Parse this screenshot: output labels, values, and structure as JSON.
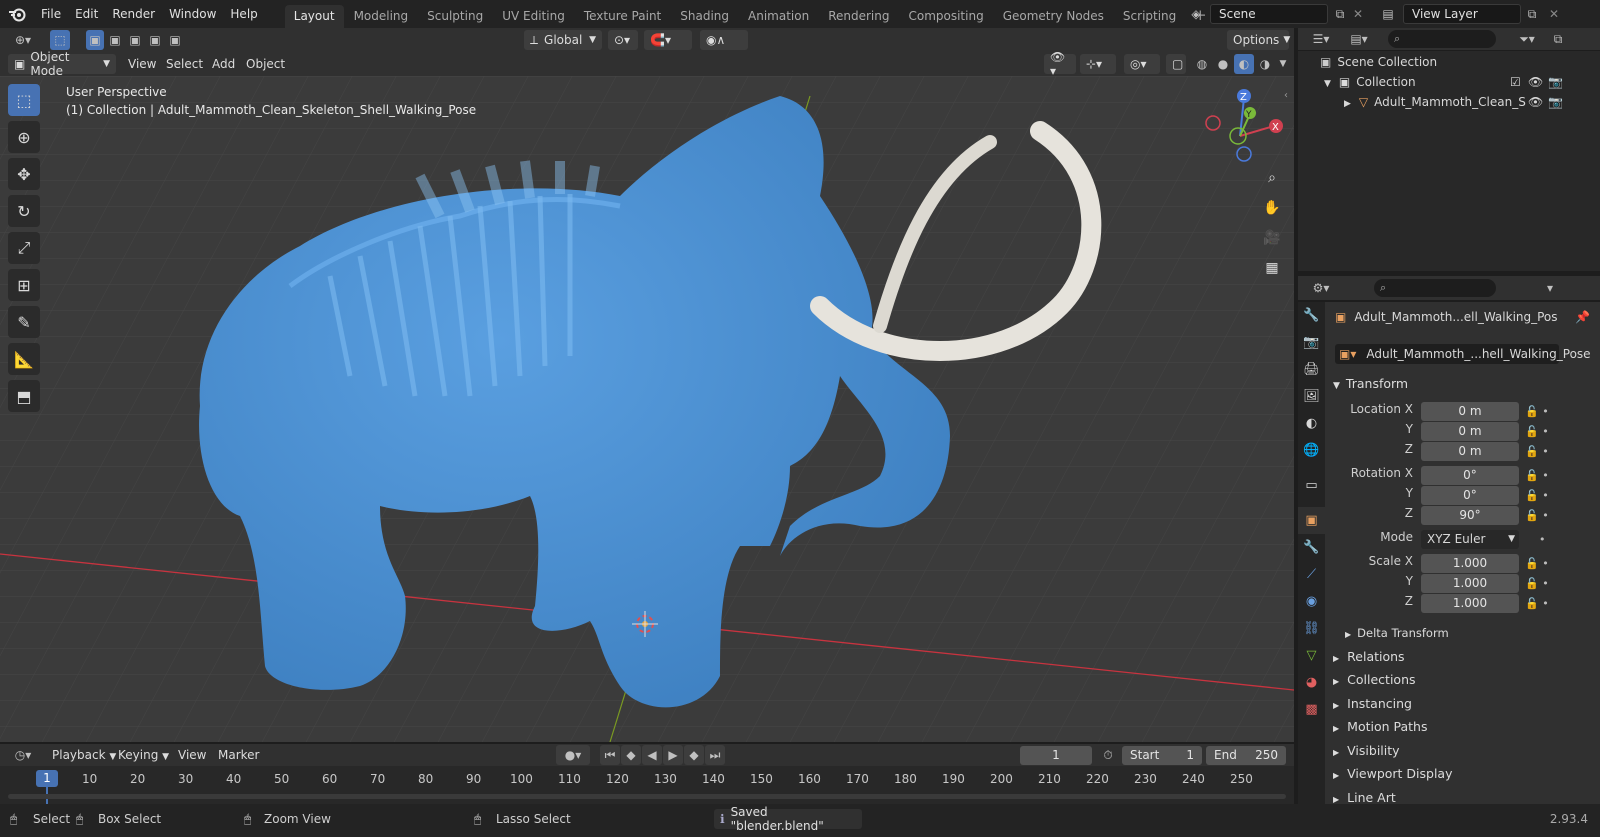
{
  "topbar": {
    "menus": [
      "File",
      "Edit",
      "Render",
      "Window",
      "Help"
    ],
    "workspaces": [
      "Layout",
      "Modeling",
      "Sculpting",
      "UV Editing",
      "Texture Paint",
      "Shading",
      "Animation",
      "Rendering",
      "Compositing",
      "Geometry Nodes",
      "Scripting"
    ],
    "active_workspace": "Layout",
    "add_symbol": "+",
    "scene_name": "Scene",
    "view_layer_name": "View Layer"
  },
  "header": {
    "orientation": "Global",
    "options_label": "Options",
    "mode_label": "Object Mode",
    "menus": [
      "View",
      "Select",
      "Add",
      "Object"
    ]
  },
  "viewport": {
    "perspective_label": "User Perspective",
    "collection_label": "(1) Collection | Adult_Mammoth_Clean_Skeleton_Shell_Walking_Pose",
    "gizmo": {
      "x": "X",
      "y": "Y",
      "z": "Z"
    },
    "colors": {
      "bg": "#3a3a3a",
      "mammoth": "#4a8fd0",
      "tusk": "#e6e3dc",
      "x_axis": "#c8333f",
      "y_axis": "#7a9a22"
    }
  },
  "outliner": {
    "scene_collection": "Scene Collection",
    "collection": "Collection",
    "object": "Adult_Mammoth_Clean_S"
  },
  "properties": {
    "object_name": "Adult_Mammoth...ell_Walking_Pos",
    "data_name": "Adult_Mammoth_...hell_Walking_Pose",
    "transform_title": "Transform",
    "location": {
      "label_x": "Location X",
      "label_y": "Y",
      "label_z": "Z",
      "x": "0 m",
      "y": "0 m",
      "z": "0 m"
    },
    "rotation": {
      "label_x": "Rotation X",
      "label_y": "Y",
      "label_z": "Z",
      "x": "0°",
      "y": "0°",
      "z": "90°"
    },
    "mode_label": "Mode",
    "mode_value": "XYZ Euler",
    "scale": {
      "label_x": "Scale X",
      "label_y": "Y",
      "label_z": "Z",
      "x": "1.000",
      "y": "1.000",
      "z": "1.000"
    },
    "delta_transform": "Delta Transform",
    "sections": [
      "Relations",
      "Collections",
      "Instancing",
      "Motion Paths",
      "Visibility",
      "Viewport Display",
      "Line Art"
    ]
  },
  "timeline": {
    "menus": [
      "Playback",
      "Keying",
      "View",
      "Marker"
    ],
    "current_frame": "1",
    "start_label": "Start",
    "start_value": "1",
    "end_label": "End",
    "end_value": "250",
    "ruler": [
      "10",
      "20",
      "30",
      "40",
      "50",
      "60",
      "70",
      "80",
      "90",
      "100",
      "110",
      "120",
      "130",
      "140",
      "150",
      "160",
      "170",
      "180",
      "190",
      "200",
      "210",
      "220",
      "230",
      "240",
      "250"
    ],
    "playhead": "1"
  },
  "statusbar": {
    "select": "Select",
    "box_select": "Box Select",
    "zoom_view": "Zoom View",
    "lasso_select": "Lasso Select",
    "saved_message": "Saved \"blender.blend\"",
    "version": "2.93.4"
  }
}
